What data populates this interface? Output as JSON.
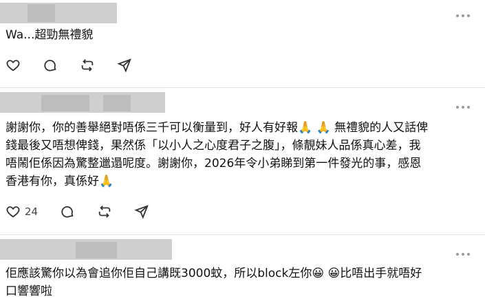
{
  "comments": [
    {
      "text": "Wa...超勁無禮貌",
      "like_count": ""
    },
    {
      "text_lines": [
        "謝謝你，你的善舉絕對唔係三千可以衡量到，好人有好報🙏 🙏 無禮貌的人又話俾",
        "錢最後又唔想俾錢，果然係「以小人之心度君子之腹」，條靚妹人品係真心差，我",
        "唔鬧佢係因為驚整邋遢呢度。謝謝你，2026年令小弟睇到第一件發光的事，感恩",
        "香港有你，真係好🙏"
      ],
      "like_count": "24"
    },
    {
      "text_lines": [
        "佢應該驚你以為會追你佢自己講既3000蚊，所以block左你😀 😀比唔出手就唔好",
        "口響響啦"
      ],
      "like_count": ""
    }
  ],
  "icons": {
    "like": "heart-icon",
    "reply": "comment-icon",
    "repost": "repost-icon",
    "share": "send-icon",
    "more": "more-icon"
  }
}
